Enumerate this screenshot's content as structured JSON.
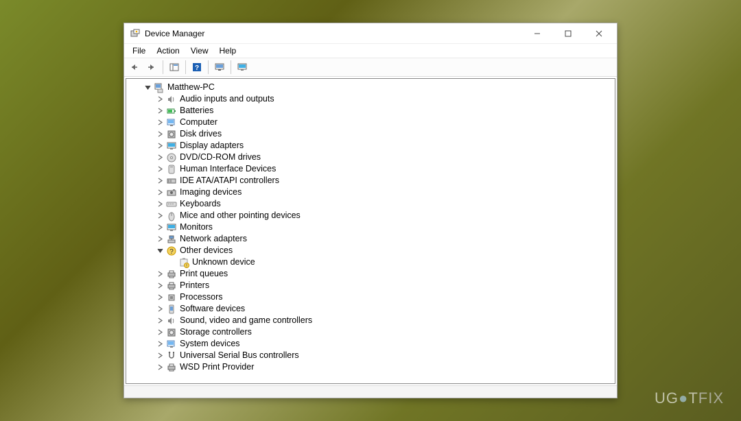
{
  "window": {
    "title": "Device Manager"
  },
  "menubar": {
    "file": "File",
    "action": "Action",
    "view": "View",
    "help": "Help"
  },
  "tree": {
    "root": "Matthew-PC",
    "items": [
      "Audio inputs and outputs",
      "Batteries",
      "Computer",
      "Disk drives",
      "Display adapters",
      "DVD/CD-ROM drives",
      "Human Interface Devices",
      "IDE ATA/ATAPI controllers",
      "Imaging devices",
      "Keyboards",
      "Mice and other pointing devices",
      "Monitors",
      "Network adapters",
      "Other devices",
      "Print queues",
      "Printers",
      "Processors",
      "Software devices",
      "Sound, video and game controllers",
      "Storage controllers",
      "System devices",
      "Universal Serial Bus controllers",
      "WSD Print Provider"
    ],
    "unknown": "Unknown device"
  },
  "watermark": {
    "a": "UG",
    "b": "T",
    "c": "FIX"
  }
}
